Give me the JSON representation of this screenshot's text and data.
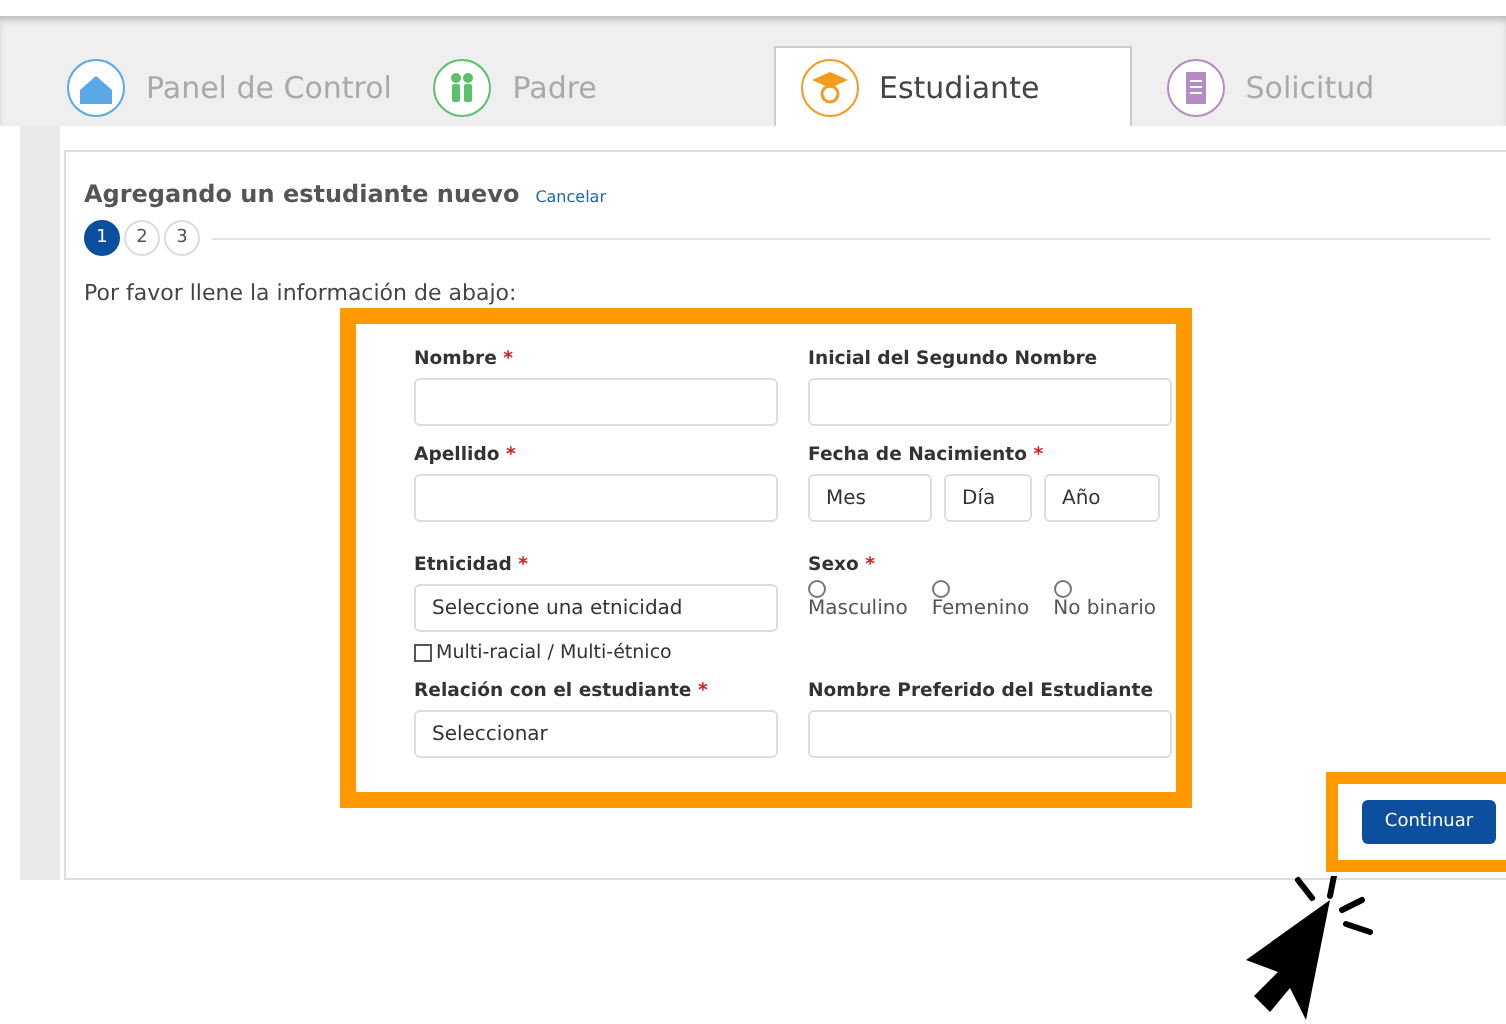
{
  "tabs": [
    {
      "label": "Panel de Control",
      "kind": "home",
      "color": "#5aa9e6",
      "selected": false
    },
    {
      "label": "Padre",
      "kind": "people",
      "color": "#5cc26a",
      "selected": false
    },
    {
      "label": "Estudiante",
      "kind": "graduate",
      "color": "#f39c1f",
      "selected": true
    },
    {
      "label": "Solicitud",
      "kind": "document",
      "color": "#b38cc4",
      "selected": false
    }
  ],
  "heading": "Agregando un estudiante nuevo",
  "cancel_link": "Cancelar",
  "steps": [
    {
      "label": "1",
      "selected": true
    },
    {
      "label": "2",
      "selected": false
    },
    {
      "label": "3",
      "selected": false
    }
  ],
  "instruction": "Por favor llene la información de abajo:",
  "form": {
    "fields": [
      {
        "kind": "text",
        "label": "Nombre",
        "required_mark": "*"
      },
      {
        "kind": "text",
        "label": "Inicial del Segundo Nombre"
      },
      {
        "kind": "text",
        "label": "Apellido",
        "required_mark": "*"
      },
      {
        "kind": "date",
        "label": "Fecha de Nacimiento",
        "required_mark": "*",
        "parts": [
          {
            "placeholder": "Mes"
          },
          {
            "placeholder": "Día"
          },
          {
            "placeholder": "Año"
          }
        ]
      },
      {
        "kind": "select",
        "label": "Etnicidad",
        "required_mark": "*",
        "value": "Seleccione una etnicidad",
        "checkbox": {
          "label": "Multi-racial / Multi-étnico",
          "checked": false
        }
      },
      {
        "kind": "radio",
        "label": "Sexo",
        "required_mark": "*",
        "options": [
          {
            "label": "Masculino",
            "selected": false
          },
          {
            "label": "Femenino",
            "selected": false
          },
          {
            "label": "No binario",
            "selected": false
          }
        ]
      },
      {
        "kind": "select",
        "label": "Relación con el estudiante",
        "required_mark": "*",
        "value": "Seleccionar"
      },
      {
        "kind": "text",
        "label": "Nombre Preferido del Estudiante"
      }
    ]
  },
  "continue_button": "Continuar"
}
